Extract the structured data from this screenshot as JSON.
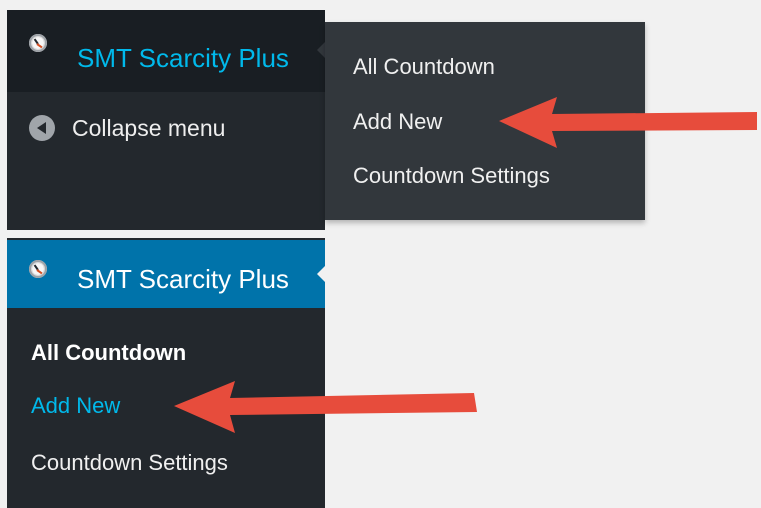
{
  "top_menu": {
    "plugin_name": "SMT Scarcity Plus",
    "collapse_label": "Collapse menu",
    "flyout_items": [
      "All Countdown",
      "Add New",
      "Countdown Settings"
    ]
  },
  "bottom_menu": {
    "plugin_name": "SMT Scarcity Plus",
    "submenu_items": [
      "All Countdown",
      "Add New",
      "Countdown Settings"
    ]
  },
  "icons": {
    "plugin": "clock-icon",
    "collapse": "collapse-arrow-icon"
  },
  "colors": {
    "sidebar_background": "#23282d",
    "top_row_background": "#191e23",
    "active_row_background": "#0073aa",
    "flyout_background": "#32373c",
    "link_blue": "#00b9eb",
    "annotation_red": "#e74c3c"
  }
}
